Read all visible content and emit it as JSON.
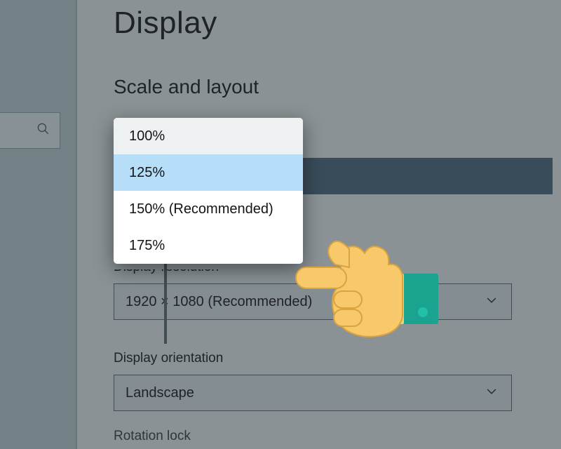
{
  "page_title": "Display",
  "section_title": "Scale and layout",
  "scale_dropdown": {
    "options": [
      "100%",
      "125%",
      "150% (Recommended)",
      "175%"
    ],
    "selected_index": 1
  },
  "resolution": {
    "label": "Display resolution",
    "value": "1920 × 1080 (Recommended)"
  },
  "orientation": {
    "label": "Display orientation",
    "value": "Landscape"
  },
  "rotation_label": "Rotation lock"
}
